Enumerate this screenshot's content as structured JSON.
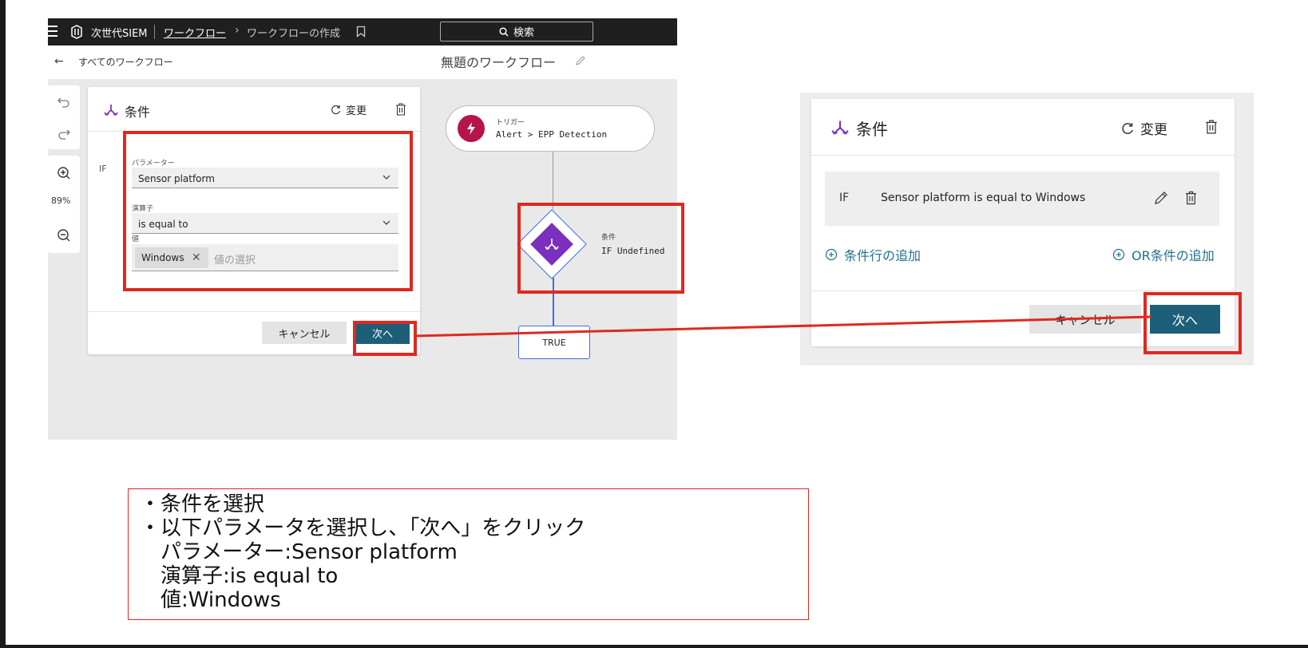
{
  "left_screenshot": {
    "app_name": "次世代SIEM",
    "breadcrumb_link": "ワークフロー",
    "breadcrumb_separator": "›",
    "breadcrumb_current": "ワークフローの作成",
    "search_label": "検索",
    "back_label": "すべてのワークフロー",
    "workflow_title": "無題のワークフロー",
    "zoom_level": "89%",
    "panel": {
      "title": "条件",
      "change_label": "変更",
      "if_label": "IF",
      "parameter_label": "パラメーター",
      "parameter_value": "Sensor platform",
      "operator_label": "演算子",
      "operator_value": "is equal to",
      "value_label": "値",
      "value_chip": "Windows",
      "value_placeholder": "値の選択",
      "cancel_label": "キャンセル",
      "next_label": "次へ"
    },
    "canvas": {
      "trigger_label": "トリガー",
      "trigger_text": "Alert > EPP Detection",
      "condition_label": "条件",
      "condition_text": "IF Undefined",
      "true_label": "TRUE"
    }
  },
  "right_screenshot": {
    "title": "条件",
    "change_label": "変更",
    "if_label": "IF",
    "if_text": "Sensor platform is equal to Windows",
    "add_row_label": "条件行の追加",
    "add_or_label": "OR条件の追加",
    "cancel_label": "キャンセル",
    "next_label": "次へ"
  },
  "instructions": [
    "・条件を選択",
    "・以下パラメータを選択し、「次へ」をクリック",
    "　パラメーター:Sensor platform",
    "　演算子:is equal to",
    "　値:Windows"
  ],
  "colors": {
    "highlight_red": "#e0281e",
    "primary_button": "#1d5f78",
    "condition_purple": "#7b2fbe",
    "trigger_magenta": "#b5154a",
    "link_teal": "#1f6f8b"
  }
}
